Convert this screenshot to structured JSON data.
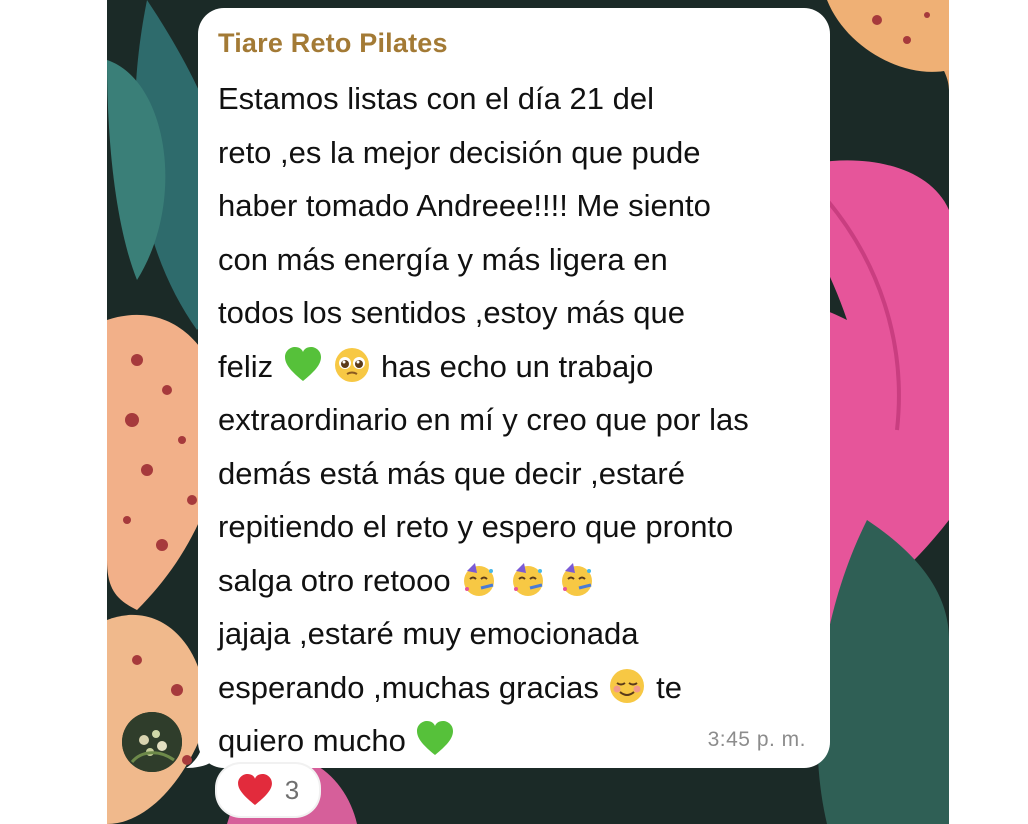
{
  "message": {
    "sender": "Tiare Reto Pilates",
    "lines": [
      "Estamos listas con el día 21 del",
      "reto ,es la mejor decisión que pude",
      "haber tomado Andreee!!!!  Me siento",
      "con más energía y más ligera en",
      "todos los sentidos ,estoy más que",
      [
        "feliz",
        " has echo un trabajo"
      ],
      "extraordinario en mí y creo que por las",
      "demás está más que decir ,estaré",
      "repitiendo el reto y espero que pronto",
      "salga otro retooo",
      "jajaja ,estaré muy emocionada",
      [
        "esperando ,muchas gracias",
        " te"
      ],
      "quiero mucho"
    ],
    "line6_a": "feliz",
    "line6_b": "has echo un trabajo",
    "line10": "salga otro retooo",
    "line12_a": "esperando ,muchas gracias",
    "line12_b": "te",
    "line13": "quiero mucho",
    "time": "3:45 p. m."
  },
  "reaction": {
    "emoji": "heart",
    "count": "3"
  },
  "icons": {
    "avatar": "sender-avatar",
    "heart_color": "#e22b3c",
    "green_heart_color": "#56c13a"
  },
  "colors": {
    "sender": "#a37a35",
    "bubble": "#ffffff",
    "text": "#111111",
    "time": "#8c8c8c"
  }
}
